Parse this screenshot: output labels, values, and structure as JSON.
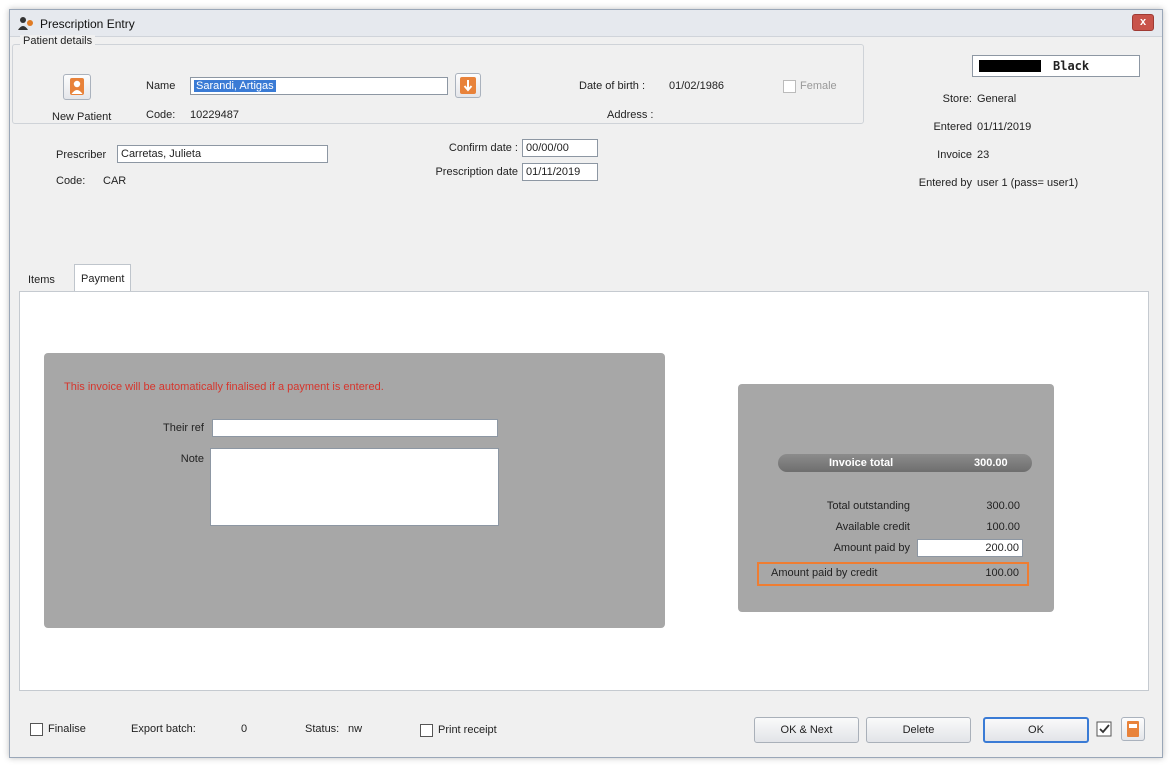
{
  "window": {
    "title": "Prescription Entry",
    "close_label": "x"
  },
  "patient": {
    "group_label": "Patient details",
    "new_patient_label": "New Patient",
    "name_label": "Name",
    "name_value": "Sarandi, Artigas",
    "code_label": "Code:",
    "code_value": "10229487",
    "dob_label": "Date of birth :",
    "dob_value": "01/02/1986",
    "female_label": "Female",
    "address_label": "Address :"
  },
  "prescriber": {
    "label": "Prescriber",
    "value": "Carretas, Julieta",
    "code_label": "Code:",
    "code_value": "CAR"
  },
  "dates": {
    "confirm_label": "Confirm date :",
    "confirm_value": "00/00/00",
    "prescription_label": "Prescription date",
    "prescription_value": "01/11/2019"
  },
  "info": {
    "color_name": "Black",
    "color_swatch": "#000000",
    "store_label": "Store:",
    "store_value": "General",
    "entered_label": "Entered",
    "entered_value": "01/11/2019",
    "invoice_label": "Invoice",
    "invoice_value": "23",
    "entered_by_label": "Entered by",
    "entered_by_value": "user 1 (pass= user1)"
  },
  "tabs": [
    "Items",
    "Payment"
  ],
  "payment": {
    "message": "This invoice will be automatically finalised if a payment is entered.",
    "their_ref_label": "Their ref",
    "their_ref_value": "",
    "note_label": "Note",
    "note_value": ""
  },
  "totals": {
    "invoice_total_label": "Invoice total",
    "invoice_total_value": "300.00",
    "outstanding_label": "Total outstanding",
    "outstanding_value": "300.00",
    "credit_label": "Available credit",
    "credit_value": "100.00",
    "paid_by_label": "Amount paid by",
    "paid_by_value": "200.00",
    "paid_credit_label": "Amount paid by credit",
    "paid_credit_value": "100.00",
    "highlight_color": "#ef7d32"
  },
  "footer": {
    "finalise_label": "Finalise",
    "export_label": "Export batch:",
    "export_value": "0",
    "status_label": "Status:",
    "status_value": "nw",
    "print_label": "Print receipt",
    "ok_next_label": "OK & Next",
    "delete_label": "Delete",
    "ok_label": "OK"
  }
}
